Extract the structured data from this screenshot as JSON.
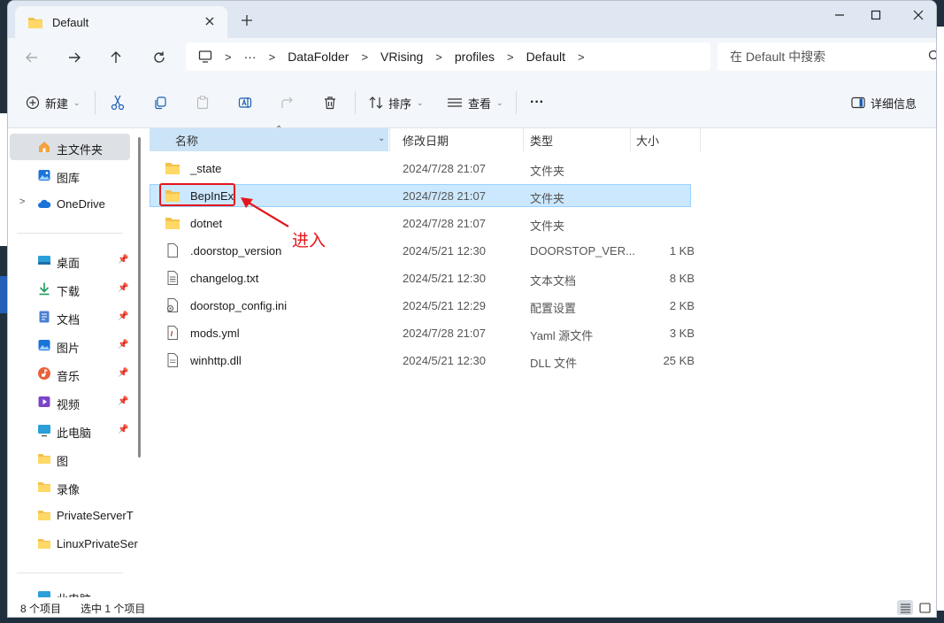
{
  "window": {
    "tab_title": "Default"
  },
  "address": {
    "crumbs": [
      "DataFolder",
      "VRising",
      "profiles",
      "Default"
    ],
    "ellipsis": "···"
  },
  "search": {
    "placeholder": "在 Default 中搜索"
  },
  "toolbar": {
    "new_label": "新建",
    "sort_label": "排序",
    "view_label": "查看",
    "more_label": "···",
    "details_label": "详细信息"
  },
  "sidebar": {
    "items": [
      {
        "label": "主文件夹",
        "icon": "home-icon"
      },
      {
        "label": "图库",
        "icon": "gallery-icon"
      },
      {
        "label": "OneDrive",
        "icon": "cloud-icon"
      },
      {
        "label": "桌面",
        "icon": "desktop-icon"
      },
      {
        "label": "下载",
        "icon": "download-icon"
      },
      {
        "label": "文档",
        "icon": "document-icon"
      },
      {
        "label": "图片",
        "icon": "pictures-icon"
      },
      {
        "label": "音乐",
        "icon": "music-icon"
      },
      {
        "label": "视频",
        "icon": "video-icon"
      },
      {
        "label": "此电脑",
        "icon": "pc-icon"
      },
      {
        "label": "图",
        "icon": "folder-icon"
      },
      {
        "label": "录像",
        "icon": "folder-icon"
      },
      {
        "label": "PrivateServerT",
        "icon": "folder-icon"
      },
      {
        "label": "LinuxPrivateSer",
        "icon": "folder-icon"
      },
      {
        "label": "此电脑",
        "icon": "pc-icon"
      }
    ]
  },
  "columns": {
    "name": "名称",
    "date": "修改日期",
    "type": "类型",
    "size": "大小"
  },
  "files": [
    {
      "name": "_state",
      "date": "2024/7/28 21:07",
      "type": "文件夹",
      "size": "",
      "icon": "folder-icon"
    },
    {
      "name": "BepInEx",
      "date": "2024/7/28 21:07",
      "type": "文件夹",
      "size": "",
      "icon": "folder-icon"
    },
    {
      "name": "dotnet",
      "date": "2024/7/28 21:07",
      "type": "文件夹",
      "size": "",
      "icon": "folder-icon"
    },
    {
      "name": ".doorstop_version",
      "date": "2024/5/21 12:30",
      "type": "DOORSTOP_VER...",
      "size": "1 KB",
      "icon": "file-icon"
    },
    {
      "name": "changelog.txt",
      "date": "2024/5/21 12:30",
      "type": "文本文档",
      "size": "8 KB",
      "icon": "text-file-icon"
    },
    {
      "name": "doorstop_config.ini",
      "date": "2024/5/21 12:29",
      "type": "配置设置",
      "size": "2 KB",
      "icon": "config-file-icon"
    },
    {
      "name": "mods.yml",
      "date": "2024/7/28 21:07",
      "type": "Yaml 源文件",
      "size": "3 KB",
      "icon": "yaml-file-icon"
    },
    {
      "name": "winhttp.dll",
      "date": "2024/5/21 12:30",
      "type": "DLL 文件",
      "size": "25 KB",
      "icon": "dll-file-icon"
    }
  ],
  "annotation": {
    "text": "进入",
    "color": "#e4161c"
  },
  "status": {
    "count": "8 个项目",
    "selected": "选中 1 个项目"
  },
  "colors": {
    "selection": "#cce8ff",
    "accent": "#0067c0",
    "folder": "#f2c24f"
  }
}
